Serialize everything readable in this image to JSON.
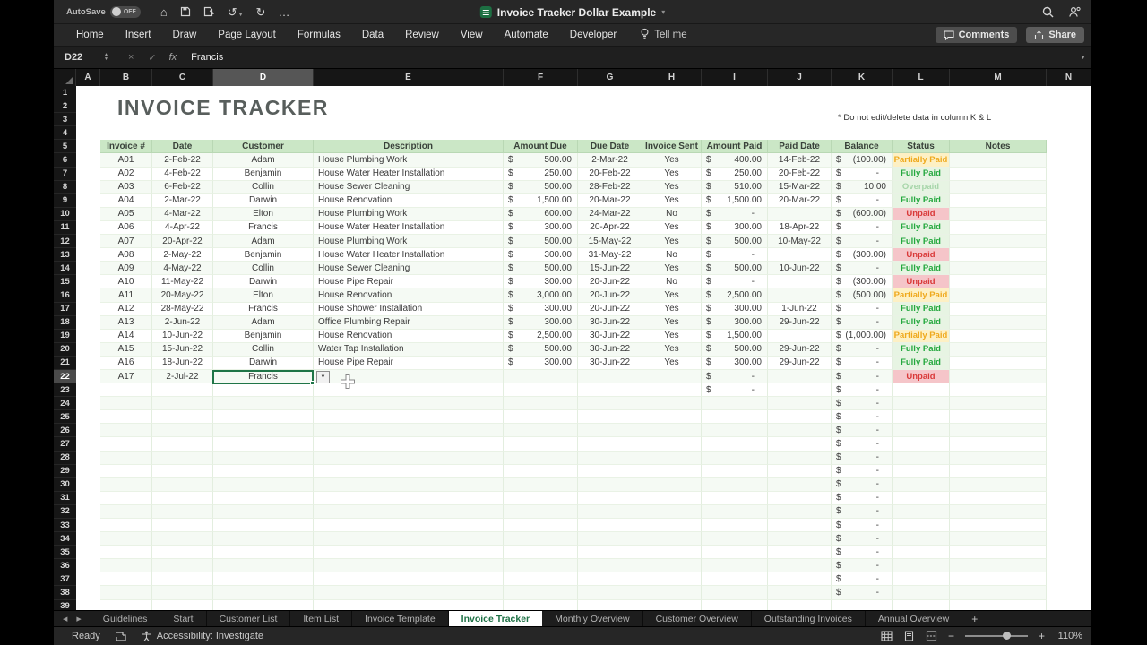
{
  "titlebar": {
    "autosave_label": "AutoSave",
    "autosave_state": "OFF",
    "title": "Invoice Tracker Dollar Example"
  },
  "ribbon": {
    "tabs": [
      "Home",
      "Insert",
      "Draw",
      "Page Layout",
      "Formulas",
      "Data",
      "Review",
      "View",
      "Automate",
      "Developer"
    ],
    "tell_me": "Tell me",
    "comments_label": "Comments",
    "share_label": "Share"
  },
  "formula_bar": {
    "name_box": "D22",
    "formula": "Francis"
  },
  "icons": {
    "home": "⌂",
    "undo": "↺",
    "redo": "↻",
    "more": "…",
    "cancel": "×",
    "enter": "✓",
    "fx": "fx",
    "spinner_up": "▲",
    "spinner_down": "▼",
    "dropdown": "▼",
    "expand": "▼",
    "title_chevron": "▾",
    "nav_left": "◀",
    "nav_right": "▶",
    "add_sheet": "+",
    "minus": "−",
    "plus": "+"
  },
  "sheet": {
    "columns": [
      "A",
      "B",
      "C",
      "D",
      "E",
      "F",
      "G",
      "H",
      "I",
      "J",
      "K",
      "L",
      "M",
      "N"
    ],
    "selected_column": "D",
    "selected_row": 22,
    "visible_rows": 39,
    "title": "INVOICE TRACKER",
    "note": "* Do not edit/delete data in column K & L",
    "headers": [
      "Invoice #",
      "Date",
      "Customer",
      "Description",
      "Amount Due",
      "Due Date",
      "Invoice Sent",
      "Amount Paid",
      "Paid Date",
      "Balance",
      "Status",
      "Notes"
    ],
    "rows": [
      {
        "row": 6,
        "invoice": "A01",
        "date": "2-Feb-22",
        "customer": "Adam",
        "description": "House Plumbing Work",
        "amount_due": "500.00",
        "due_date": "2-Mar-22",
        "invoice_sent": "Yes",
        "amount_paid": "400.00",
        "paid_date": "14-Feb-22",
        "balance": "(100.00)",
        "status": "Partially Paid"
      },
      {
        "row": 7,
        "invoice": "A02",
        "date": "4-Feb-22",
        "customer": "Benjamin",
        "description": "House Water Heater Installation",
        "amount_due": "250.00",
        "due_date": "20-Feb-22",
        "invoice_sent": "Yes",
        "amount_paid": "250.00",
        "paid_date": "20-Feb-22",
        "balance": "-",
        "status": "Fully Paid"
      },
      {
        "row": 8,
        "invoice": "A03",
        "date": "6-Feb-22",
        "customer": "Collin",
        "description": "House Sewer Cleaning",
        "amount_due": "500.00",
        "due_date": "28-Feb-22",
        "invoice_sent": "Yes",
        "amount_paid": "510.00",
        "paid_date": "15-Mar-22",
        "balance": "10.00",
        "status": "Overpaid"
      },
      {
        "row": 9,
        "invoice": "A04",
        "date": "2-Mar-22",
        "customer": "Darwin",
        "description": "House Renovation",
        "amount_due": "1,500.00",
        "due_date": "20-Mar-22",
        "invoice_sent": "Yes",
        "amount_paid": "1,500.00",
        "paid_date": "20-Mar-22",
        "balance": "-",
        "status": "Fully Paid"
      },
      {
        "row": 10,
        "invoice": "A05",
        "date": "4-Mar-22",
        "customer": "Elton",
        "description": "House Plumbing Work",
        "amount_due": "600.00",
        "due_date": "24-Mar-22",
        "invoice_sent": "No",
        "amount_paid": "-",
        "paid_date": "",
        "balance": "(600.00)",
        "status": "Unpaid"
      },
      {
        "row": 11,
        "invoice": "A06",
        "date": "4-Apr-22",
        "customer": "Francis",
        "description": "House Water Heater Installation",
        "amount_due": "300.00",
        "due_date": "20-Apr-22",
        "invoice_sent": "Yes",
        "amount_paid": "300.00",
        "paid_date": "18-Apr-22",
        "balance": "-",
        "status": "Fully Paid"
      },
      {
        "row": 12,
        "invoice": "A07",
        "date": "20-Apr-22",
        "customer": "Adam",
        "description": "House Plumbing Work",
        "amount_due": "500.00",
        "due_date": "15-May-22",
        "invoice_sent": "Yes",
        "amount_paid": "500.00",
        "paid_date": "10-May-22",
        "balance": "-",
        "status": "Fully Paid"
      },
      {
        "row": 13,
        "invoice": "A08",
        "date": "2-May-22",
        "customer": "Benjamin",
        "description": "House Water Heater Installation",
        "amount_due": "300.00",
        "due_date": "31-May-22",
        "invoice_sent": "No",
        "amount_paid": "-",
        "paid_date": "",
        "balance": "(300.00)",
        "status": "Unpaid"
      },
      {
        "row": 14,
        "invoice": "A09",
        "date": "4-May-22",
        "customer": "Collin",
        "description": "House Sewer Cleaning",
        "amount_due": "500.00",
        "due_date": "15-Jun-22",
        "invoice_sent": "Yes",
        "amount_paid": "500.00",
        "paid_date": "10-Jun-22",
        "balance": "-",
        "status": "Fully Paid"
      },
      {
        "row": 15,
        "invoice": "A10",
        "date": "11-May-22",
        "customer": "Darwin",
        "description": "House Pipe Repair",
        "amount_due": "300.00",
        "due_date": "20-Jun-22",
        "invoice_sent": "No",
        "amount_paid": "-",
        "paid_date": "",
        "balance": "(300.00)",
        "status": "Unpaid"
      },
      {
        "row": 16,
        "invoice": "A11",
        "date": "20-May-22",
        "customer": "Elton",
        "description": "House Renovation",
        "amount_due": "3,000.00",
        "due_date": "20-Jun-22",
        "invoice_sent": "Yes",
        "amount_paid": "2,500.00",
        "paid_date": "",
        "balance": "(500.00)",
        "status": "Partially Paid"
      },
      {
        "row": 17,
        "invoice": "A12",
        "date": "28-May-22",
        "customer": "Francis",
        "description": "House Shower Installation",
        "amount_due": "300.00",
        "due_date": "20-Jun-22",
        "invoice_sent": "Yes",
        "amount_paid": "300.00",
        "paid_date": "1-Jun-22",
        "balance": "-",
        "status": "Fully Paid"
      },
      {
        "row": 18,
        "invoice": "A13",
        "date": "2-Jun-22",
        "customer": "Adam",
        "description": "Office Plumbing Repair",
        "amount_due": "300.00",
        "due_date": "30-Jun-22",
        "invoice_sent": "Yes",
        "amount_paid": "300.00",
        "paid_date": "29-Jun-22",
        "balance": "-",
        "status": "Fully Paid"
      },
      {
        "row": 19,
        "invoice": "A14",
        "date": "10-Jun-22",
        "customer": "Benjamin",
        "description": "House Renovation",
        "amount_due": "2,500.00",
        "due_date": "30-Jun-22",
        "invoice_sent": "Yes",
        "amount_paid": "1,500.00",
        "paid_date": "",
        "balance": "(1,000.00)",
        "status": "Partially Paid"
      },
      {
        "row": 20,
        "invoice": "A15",
        "date": "15-Jun-22",
        "customer": "Collin",
        "description": "Water Tap Installation",
        "amount_due": "500.00",
        "due_date": "30-Jun-22",
        "invoice_sent": "Yes",
        "amount_paid": "500.00",
        "paid_date": "29-Jun-22",
        "balance": "-",
        "status": "Fully Paid"
      },
      {
        "row": 21,
        "invoice": "A16",
        "date": "18-Jun-22",
        "customer": "Darwin",
        "description": "House Pipe Repair",
        "amount_due": "300.00",
        "due_date": "30-Jun-22",
        "invoice_sent": "Yes",
        "amount_paid": "300.00",
        "paid_date": "29-Jun-22",
        "balance": "-",
        "status": "Fully Paid"
      },
      {
        "row": 22,
        "invoice": "A17",
        "date": "2-Jul-22",
        "customer": "Francis",
        "description": "",
        "amount_due": "",
        "due_date": "",
        "invoice_sent": "",
        "amount_paid": "-",
        "paid_date": "",
        "balance": "-",
        "status": "Unpaid"
      },
      {
        "row": 23,
        "invoice": "",
        "date": "",
        "customer": "",
        "description": "",
        "amount_due": "",
        "due_date": "",
        "invoice_sent": "",
        "amount_paid": "-",
        "paid_date": "",
        "balance": "-",
        "status": ""
      },
      {
        "row": 24,
        "balance": "-"
      },
      {
        "row": 25,
        "balance": "-"
      },
      {
        "row": 26,
        "balance": "-"
      },
      {
        "row": 27,
        "balance": "-"
      },
      {
        "row": 28,
        "balance": "-"
      },
      {
        "row": 29,
        "balance": "-"
      },
      {
        "row": 30,
        "balance": "-"
      },
      {
        "row": 31,
        "balance": "-"
      },
      {
        "row": 32,
        "balance": "-"
      },
      {
        "row": 33,
        "balance": "-"
      },
      {
        "row": 34,
        "balance": "-"
      },
      {
        "row": 35,
        "balance": "-"
      },
      {
        "row": 36,
        "balance": "-"
      },
      {
        "row": 37,
        "balance": "-"
      },
      {
        "row": 38,
        "balance": "-"
      }
    ]
  },
  "status_colors": {
    "Fully Paid": {
      "bg": "#e7f4e3",
      "text": "#24a83e"
    },
    "Partially Paid": {
      "bg": "#fdf0c4",
      "text": "#efa91d"
    },
    "Unpaid": {
      "bg": "#f5c5c9",
      "text": "#d93838"
    },
    "Overpaid": {
      "bg": "#e7f4e3",
      "text": "#a6d5a9"
    }
  },
  "theme": {
    "accent_green": "#1e7145",
    "header_row_bg": "#cbe7c6",
    "selection_border": "#1f7547"
  },
  "sheet_tabs": {
    "items": [
      {
        "label": "Guidelines",
        "active": false
      },
      {
        "label": "Start",
        "active": false
      },
      {
        "label": "Customer List",
        "active": false
      },
      {
        "label": "Item List",
        "active": false
      },
      {
        "label": "Invoice Template",
        "active": false
      },
      {
        "label": "Invoice Tracker",
        "active": true
      },
      {
        "label": "Monthly Overview",
        "active": false
      },
      {
        "label": "Customer Overview",
        "active": false
      },
      {
        "label": "Outstanding Invoices",
        "active": false
      },
      {
        "label": "Annual Overview",
        "active": false
      }
    ]
  },
  "status_bar": {
    "ready": "Ready",
    "accessibility": "Accessibility: Investigate",
    "zoom": "110%"
  }
}
